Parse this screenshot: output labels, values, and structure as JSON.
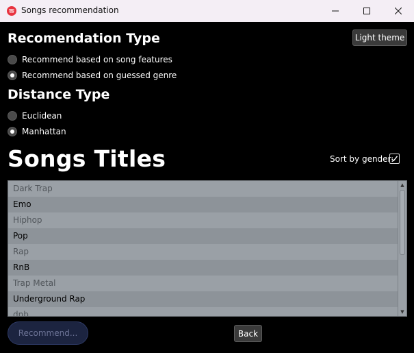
{
  "window": {
    "title": "Songs recommendation"
  },
  "recommendation": {
    "heading": "Recomendation Type",
    "options": [
      {
        "label": "Recommend based on song features",
        "checked": false
      },
      {
        "label": "Recommend based on guessed genre",
        "checked": true
      }
    ]
  },
  "distance": {
    "heading": "Distance Type",
    "options": [
      {
        "label": "Euclidean",
        "checked": false
      },
      {
        "label": "Manhattan",
        "checked": true
      }
    ]
  },
  "theme_button": "Light theme",
  "songs": {
    "title": "Songs Titles",
    "sort_label": "Sort by gender:",
    "sort_checked": true,
    "items": [
      "Dark Trap",
      "Emo",
      "Hiphop",
      "Pop",
      "Rap",
      "RnB",
      "Trap Metal",
      "Underground Rap",
      "dnb"
    ]
  },
  "buttons": {
    "recommend": "Recommend...",
    "back": "Back"
  },
  "colors": {
    "accent": "#e8333f",
    "background": "#000000",
    "list_bg": "#8e949b"
  }
}
